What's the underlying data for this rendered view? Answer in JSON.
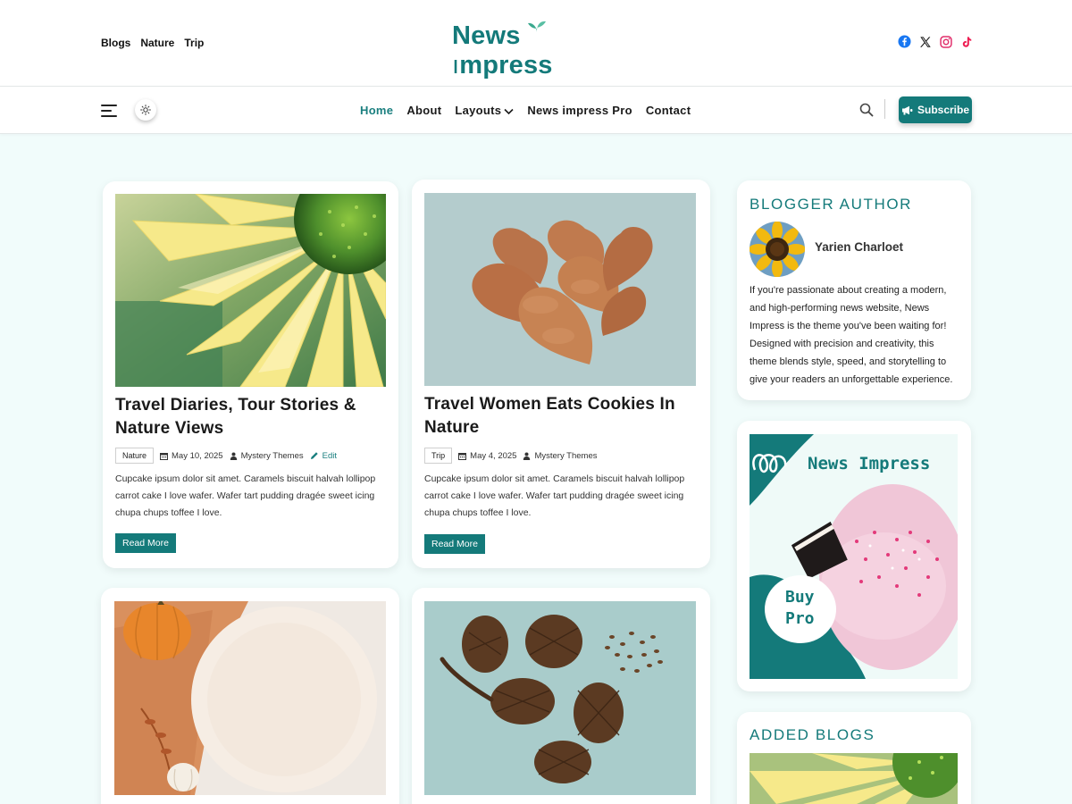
{
  "header": {
    "top_links": [
      "Blogs",
      "Nature",
      "Trip"
    ],
    "logo_text_left": "News",
    "logo_text_right": "mpress",
    "social": [
      "facebook-icon",
      "x-icon",
      "instagram-icon",
      "tiktok-icon"
    ]
  },
  "nav": {
    "items": [
      "Home",
      "About",
      "Layouts",
      "News impress Pro",
      "Contact"
    ],
    "active": "Home",
    "subscribe_label": "Subscribe"
  },
  "posts": [
    {
      "title": "Travel Diaries, Tour Stories & Nature Views",
      "tag": "Nature",
      "date": "May 10, 2025",
      "author": "Mystery Themes",
      "edit_label": "Edit",
      "excerpt": "Cupcake ipsum dolor sit amet. Caramels biscuit halvah lollipop carrot cake I love wafer. Wafer tart pudding dragée sweet icing chupa chups toffee I love.",
      "read_more": "Read More"
    },
    {
      "title": "Travel Women Eats Cookies In Nature",
      "tag": "Trip",
      "date": "May 4, 2025",
      "author": "Mystery Themes",
      "excerpt": "Cupcake ipsum dolor sit amet. Caramels biscuit halvah lollipop carrot cake I love wafer. Wafer tart pudding dragée sweet icing chupa chups toffee I love.",
      "read_more": "Read More"
    }
  ],
  "sidebar": {
    "author_heading": "BLOGGER AUTHOR",
    "author_name": "Yarien Charloet",
    "author_bio": "If you're passionate about creating a modern, and high-performing news website, News Impress is the theme you've been waiting for! Designed with precision and creativity, this theme blends style, speed, and storytelling to give your readers an unforgettable experience.",
    "promo_title": "News Impress",
    "promo_buy": "Buy",
    "promo_pro": "Pro",
    "added_heading": "ADDED BLOGS"
  },
  "colors": {
    "accent": "#147a7a",
    "background": "#f1fcfb"
  }
}
